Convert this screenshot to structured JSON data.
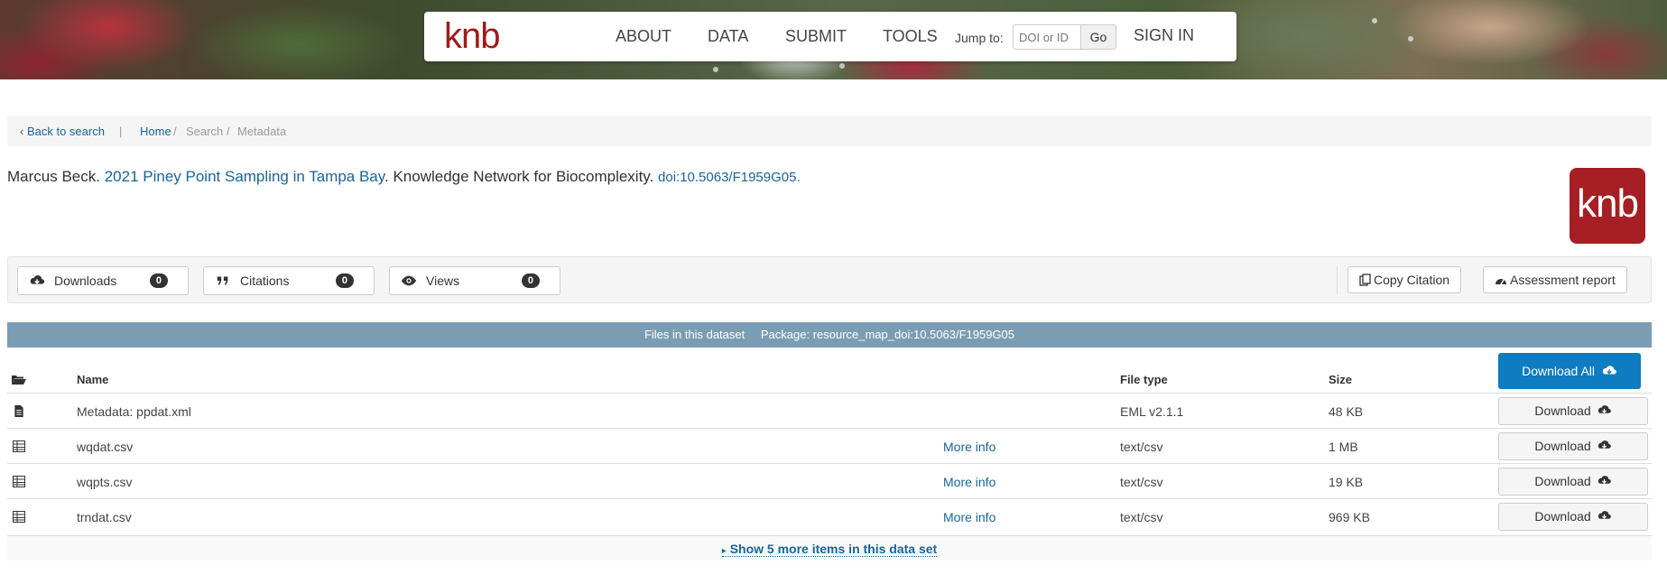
{
  "nav": {
    "logo": "knb",
    "items": [
      "ABOUT",
      "DATA",
      "SUBMIT",
      "TOOLS"
    ],
    "jump_label": "Jump to:",
    "jump_placeholder": "DOI or ID",
    "go_label": "Go",
    "signin_label": "SIGN IN"
  },
  "breadcrumb": {
    "back": "Back to search",
    "home": "Home",
    "search": "Search",
    "current": "Metadata"
  },
  "citation": {
    "author": "Marcus Beck.",
    "title": "2021 Piney Point Sampling in Tampa Bay",
    "publisher": ". Knowledge Network for Biocomplexity.",
    "doi": "doi:10.5063/F1959G05",
    "badge": "knb"
  },
  "metrics": {
    "downloads_label": "Downloads",
    "downloads_count": "0",
    "citations_label": "Citations",
    "citations_count": "0",
    "views_label": "Views",
    "views_count": "0",
    "copy_citation": "Copy Citation",
    "assessment": "Assessment report"
  },
  "files": {
    "header_title": "Files in this dataset",
    "package": "Package: resource_map_doi:10.5063/F1959G05",
    "col_name": "Name",
    "col_type": "File type",
    "col_size": "Size",
    "download_all": "Download All",
    "more_info": "More info",
    "download": "Download",
    "rows": [
      {
        "name": "Metadata: ppdat.xml",
        "type": "EML v2.1.1",
        "size": "48 KB",
        "more": ""
      },
      {
        "name": "wqdat.csv",
        "type": "text/csv",
        "size": "1 MB",
        "more": "More info"
      },
      {
        "name": "wqpts.csv",
        "type": "text/csv",
        "size": "19 KB",
        "more": "More info"
      },
      {
        "name": "trndat.csv",
        "type": "text/csv",
        "size": "969 KB",
        "more": "More info"
      }
    ],
    "show_more": "Show 5 more items in this data set"
  }
}
